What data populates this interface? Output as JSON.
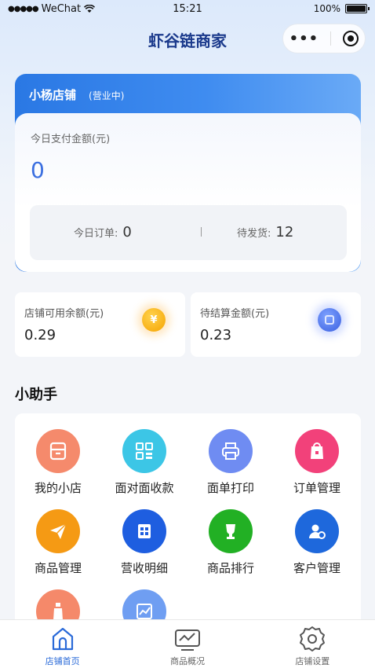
{
  "status_bar": {
    "carrier": "WeChat",
    "time": "15:21",
    "battery": "100%",
    "battery_level": 1.0
  },
  "nav": {
    "title": "虾谷链商家",
    "more_icon": "more-dots-icon",
    "close_icon": "target-icon"
  },
  "shop": {
    "name": "小杨店铺",
    "status": "(营业中)",
    "pay_label": "今日支付金额(元)",
    "pay_value": "0",
    "orders_label": "今日订单:",
    "orders_value": "0",
    "divider": "|",
    "pending_label": "待发货:",
    "pending_value": "12"
  },
  "balances": [
    {
      "label": "店铺可用余额(元)",
      "value": "0.29",
      "icon": "yuan-coin-icon",
      "glyph": "¥"
    },
    {
      "label": "待结算金额(元)",
      "value": "0.23",
      "icon": "pending-coin-icon",
      "glyph": ""
    }
  ],
  "assistant": {
    "title": "小助手",
    "tools": [
      {
        "label": "我的小店",
        "icon": "store-icon",
        "color": "#f58a6c"
      },
      {
        "label": "面对面收款",
        "icon": "qrcode-icon",
        "color": "#3cc6e6"
      },
      {
        "label": "面单打印",
        "icon": "printer-icon",
        "color": "#6f8cf2"
      },
      {
        "label": "订单管理",
        "icon": "order-bag-icon",
        "color": "#f2417a"
      },
      {
        "label": "商品管理",
        "icon": "paper-plane-icon",
        "color": "#f59a14"
      },
      {
        "label": "营收明细",
        "icon": "ledger-icon",
        "color": "#1e5ee0"
      },
      {
        "label": "商品排行",
        "icon": "trophy-icon",
        "color": "#22b024"
      },
      {
        "label": "客户管理",
        "icon": "customer-icon",
        "color": "#1e68dc"
      },
      {
        "label": "",
        "icon": "bottle-icon",
        "color": "#f5896a"
      },
      {
        "label": "",
        "icon": "trend-chart-icon",
        "color": "#6f9ef2"
      }
    ]
  },
  "tabbar": [
    {
      "label": "店铺首页",
      "icon": "home-icon",
      "active": true
    },
    {
      "label": "商品概况",
      "icon": "chart-monitor-icon",
      "active": false
    },
    {
      "label": "店铺设置",
      "icon": "settings-gear-icon",
      "active": false
    }
  ]
}
